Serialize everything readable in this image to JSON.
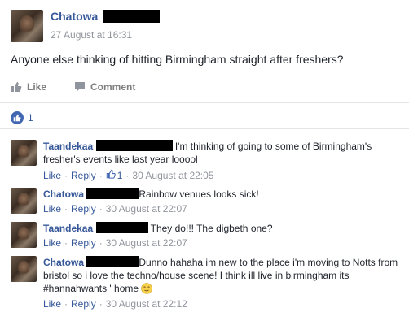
{
  "post": {
    "author": "Chatowa",
    "timestamp": "27 August at 16:31",
    "text": "Anyone else thinking of hitting Birmingham straight after freshers?",
    "like_label": "Like",
    "comment_label": "Comment",
    "like_count": "1"
  },
  "comments": [
    {
      "author": "Taandekaa",
      "text": "I'm thinking of going to some of Birmingham's fresher's events like last year looool",
      "like_label": "Like",
      "reply_label": "Reply",
      "reaction_count": "1",
      "timestamp": "30 August at 22:05"
    },
    {
      "author": "Chatowa",
      "text": "Rainbow venues looks sick!",
      "like_label": "Like",
      "reply_label": "Reply",
      "timestamp": "30 August at 22:07"
    },
    {
      "author": "Taandekaa",
      "text": "They do!!! The digbeth one?",
      "like_label": "Like",
      "reply_label": "Reply",
      "timestamp": "30 August at 22:07"
    },
    {
      "author": "Chatowa",
      "text": "Dunno hahaha im new to the place i'm moving to Notts from bristol so i love the techno/house scene! I think ill live in birmingham its #hannahwants ' home",
      "like_label": "Like",
      "reply_label": "Reply",
      "timestamp": "30 August at 22:12"
    }
  ],
  "colors": {
    "link": "#365899",
    "meta": "#90949c",
    "like_badge": "#4267b2"
  }
}
